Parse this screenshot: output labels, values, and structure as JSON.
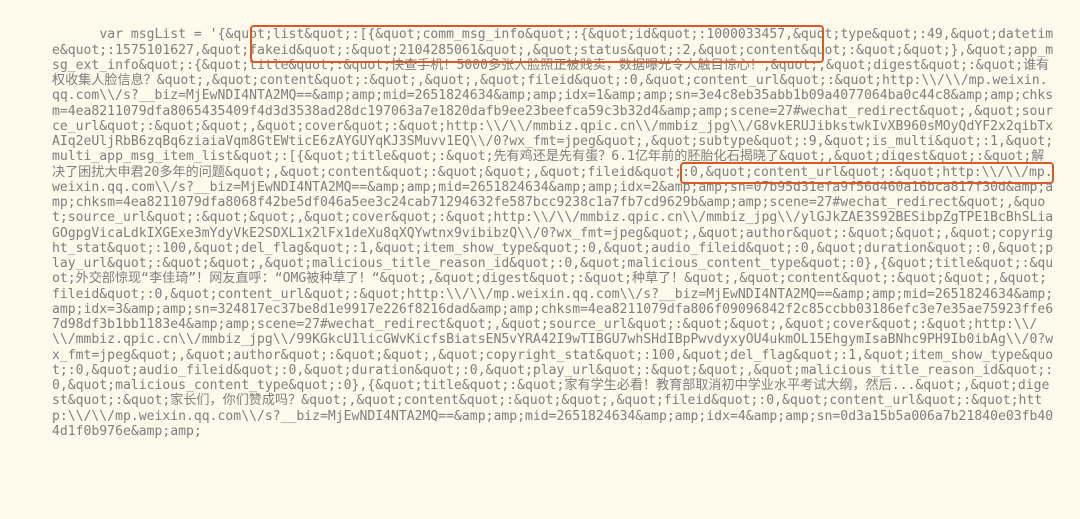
{
  "code_text": "    var msgList = '{&quot;list&quot;:[{&quot;comm_msg_info&quot;:{&quot;id&quot;:1000033457,&quot;type&quot;:49,&quot;datetime&quot;:1575101627,&quot;fakeid&quot;:&quot;2104285061&quot;,&quot;status&quot;:2,&quot;content&quot;:&quot;&quot;},&quot;app_msg_ext_info&quot;:{&quot;title&quot;:&quot;快查手机！5000多张人脸照正被贱卖，数据曝光令人触目惊心！,&quot;,&quot;digest&quot;:&quot;谁有权收集人脸信息？&quot;,&quot;content&quot;:&quot;,&quot;,&quot;fileid&quot;:0,&quot;content_url&quot;:&quot;http:\\\\/\\\\/mp.weixin.qq.com\\\\/s?__biz=MjEwNDI4NTA2MQ==&amp;amp;mid=2651824634&amp;amp;idx=1&amp;amp;sn=3e4c8eb35abb1b09a4077064ba0c44c8&amp;amp;chksm=4ea8211079dfa8065435409f4d3d3538ad28dc197063a7e1820dafb9ee23beefca59c3b32d4&amp;amp;scene=27#wechat_redirect&quot;,&quot;source_url&quot;:&quot;&quot;,&quot;cover&quot;:&quot;http:\\\\/\\\\/mmbiz.qpic.cn\\\\/mmbiz_jpg\\\\/G8vkERUJibkstwkIvXB960sMOyQdYF2x2qibTxAIq2eUljRbB6zqBq6ziaiaVqm8GtEWticE6zAYGUYqKJ3SMuvv1EQ\\\\/0?wx_fmt=jpeg&quot;,&quot;subtype&quot;:9,&quot;is_multi&quot;:1,&quot;multi_app_msg_item_list&quot;:[{&quot;title&quot;:&quot;先有鸡还是先有蛋？6.1亿年前的胚胎化石揭晓了&quot;,&quot;digest&quot;:&quot;解决了困扰大申君20多年的问题&quot;,&quot;content&quot;:&quot;&quot;,&quot;fileid&quot;:0,&quot;content_url&quot;:&quot;http:\\\\/\\\\/mp.weixin.qq.com\\\\/s?__biz=MjEwNDI4NTA2MQ==&amp;amp;mid=2651824634&amp;amp;idx=2&amp;amp;sn=07b95d31efa9f56d460a16bca817f30d&amp;amp;chksm=4ea8211079dfa8068f42be5df046a5ee3c24cab71294632fe587bcc9238c1a7fb7cd9629b&amp;amp;scene=27#wechat_redirect&quot;,&quot;source_url&quot;:&quot;&quot;,&quot;cover&quot;:&quot;http:\\\\/\\\\/mmbiz.qpic.cn\\\\/mmbiz_jpg\\\\/ylGJkZAE3S92BESibpZgTPE1BcBhSLiaGOgpgVicaLdkIXGExe3mYdyVkE2SDXL1x2lFx1deXu8qXQYwtnx9vibibzQ\\\\/0?wx_fmt=jpeg&quot;,&quot;author&quot;:&quot;&quot;,&quot;copyright_stat&quot;:100,&quot;del_flag&quot;:1,&quot;item_show_type&quot;:0,&quot;audio_fileid&quot;:0,&quot;duration&quot;:0,&quot;play_url&quot;:&quot;&quot;,&quot;malicious_title_reason_id&quot;:0,&quot;malicious_content_type&quot;:0},{&quot;title&quot;:&quot;外交部惊现“李佳琦”！网友直呼：“OMG被种草了！“&quot;,&quot;digest&quot;:&quot;种草了！&quot;,&quot;content&quot;:&quot;&quot;,&quot;fileid&quot;:0,&quot;content_url&quot;:&quot;http:\\\\/\\\\/mp.weixin.qq.com\\\\/s?__biz=MjEwNDI4NTA2MQ==&amp;amp;mid=2651824634&amp;amp;idx=3&amp;amp;sn=324817ec37be8d1e9917e226f8216dad&amp;amp;chksm=4ea8211079dfa806f09096842f2c85ccbb03186efc3e7e35ae75923ffe67d98df3b1bb1183e4&amp;amp;scene=27#wechat_redirect&quot;,&quot;source_url&quot;:&quot;&quot;,&quot;cover&quot;:&quot;http:\\\\/\\\\/mmbiz.qpic.cn\\\\/mmbiz_jpg\\\\/99KGkcU1licGWvKicfsBiatsEN5vYRA42I9wTIBGU7whSHdIBpPwvdyxyOU4ukmOL15EhgymIsaBNhc9PH9Ib0ibAg\\\\/0?wx_fmt=jpeg&quot;,&quot;author&quot;:&quot;&quot;,&quot;copyright_stat&quot;:100,&quot;del_flag&quot;:1,&quot;item_show_type&quot;:0,&quot;audio_fileid&quot;:0,&quot;duration&quot;:0,&quot;play_url&quot;:&quot;&quot;,&quot;malicious_title_reason_id&quot;:0,&quot;malicious_content_type&quot;:0},{&quot;title&quot;:&quot;家有学生必看！教育部取消初中学业水平考试大纲，然后...&quot;,&quot;digest&quot;:&quot;家长们，你们赞成吗？&quot;,&quot;content&quot;:&quot;&quot;,&quot;fileid&quot;:0,&quot;content_url&quot;:&quot;http:\\\\/\\\\/mp.weixin.qq.com\\\\/s?__biz=MjEwNDI4NTA2MQ==&amp;amp;mid=2651824634&amp;amp;idx=4&amp;amp;sn=0d3a15b5a006a7b21840e03fb404d1f0b976e&amp;amp;"
}
